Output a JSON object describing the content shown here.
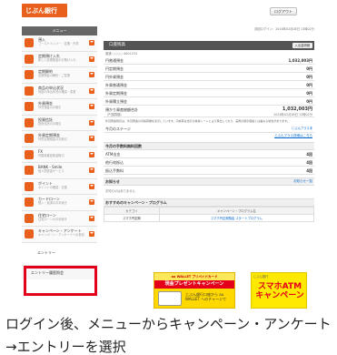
{
  "header": {
    "logo_text": "じぶん銀行",
    "logout_label": "ログアウト"
  },
  "sidebar": {
    "title": "メニュー",
    "items": [
      {
        "title": "預入",
        "sub": "ゴールドメンバー・定期・外貨"
      },
      {
        "title": "定期預け入れ",
        "sub": "新しい定期預金のお預け入れ"
      },
      {
        "title": "定期解約",
        "sub": "定期預金の解約・ご変更"
      },
      {
        "title": "商品の申込状況",
        "sub": "商品の申込状況の確認・変更"
      },
      {
        "title": "外貨預金",
        "sub": "外貨預金のお取引"
      },
      {
        "title": "投資信託",
        "sub": "投資信託のお取引"
      },
      {
        "title": "外貨定期預金",
        "sub": "外貨定期預金のお取引"
      },
      {
        "title": "FX",
        "sub": "外国為替証拠金取引"
      },
      {
        "title": "BANK・Smile",
        "sub": "個人間送金サービス"
      },
      {
        "title": "ポイント",
        "sub": "ポイントの確認・交換"
      },
      {
        "title": "カードローン",
        "sub": "借入・返済のお手続き"
      },
      {
        "title": "住宅ローン",
        "sub": "住宅ローンのお手続き"
      },
      {
        "title": "キャンペーン・アンケート",
        "sub": "キャンペーン・アンケートへの参加"
      }
    ],
    "entry_label": "エントリー",
    "entry_history_label": "エントリー履歴照会"
  },
  "main": {
    "last_login": "前回ログイン：2016年02月08日 13時02分",
    "account_title": "口座残高",
    "account_button": "入出金明細",
    "account_number": "普通 ○○○○ 0001234",
    "balances": [
      {
        "label": "円普通預金",
        "value": "1,032,003円"
      },
      {
        "label": "円定期預金",
        "value": "0円"
      },
      {
        "label": "円外貨預金",
        "value": "0円"
      },
      {
        "label": "外貨普通預金",
        "value": "0円"
      },
      {
        "label": "外貨定期預金",
        "value": "0円"
      },
      {
        "label": "外貨積立預金",
        "value": "0円"
      }
    ],
    "total_label": "預かり資産総額合計",
    "total_sub": "（円換算額）",
    "total_value": "1,032,003円",
    "total_date": "2016年02月08日 13時02分",
    "notes": "外貨預金残高は、外貨預金の円換算額を表示しています。円換算は当行の為替レートにより算出しており、実際の取引価格とは異なる場合があります。",
    "stage_label": "今月のステージ",
    "stage_link": "じぶんプラス未",
    "stage_link2": "じぶんプラス詳細はこちら",
    "fees": {
      "heading": "今月の手数料無料回数",
      "rows": [
        {
          "label": "ATM出金",
          "value": "4回"
        },
        {
          "label": "他行宛振込",
          "value": "4回"
        },
        {
          "label": "振込手数料",
          "value": "4回"
        }
      ]
    },
    "notice_label": "お知らせ",
    "notice_link": "お知らせ一覧",
    "notice_text": "お知らせはありません",
    "campaign": {
      "heading": "おすすめのキャンペーン・プログラム",
      "headers": [
        "カテゴリ",
        "キャンペーン・プログラム名"
      ],
      "rows": [
        {
          "category": "スマホ円定期",
          "name": "スマホ円定期預金 スタートプログラム"
        }
      ]
    },
    "banner1": {
      "top": "au WALLET プリペイドカード",
      "mid": "現金プレゼントキャンペーン",
      "text": "じぶん銀行口座から au WALLET へのチャージで"
    },
    "banner2": {
      "logo": "じぶん銀行",
      "text": "スマホATM キャンペーン"
    }
  },
  "caption": "ログイン後、メニューからキャンペーン・アンケート→エントリーを選択"
}
